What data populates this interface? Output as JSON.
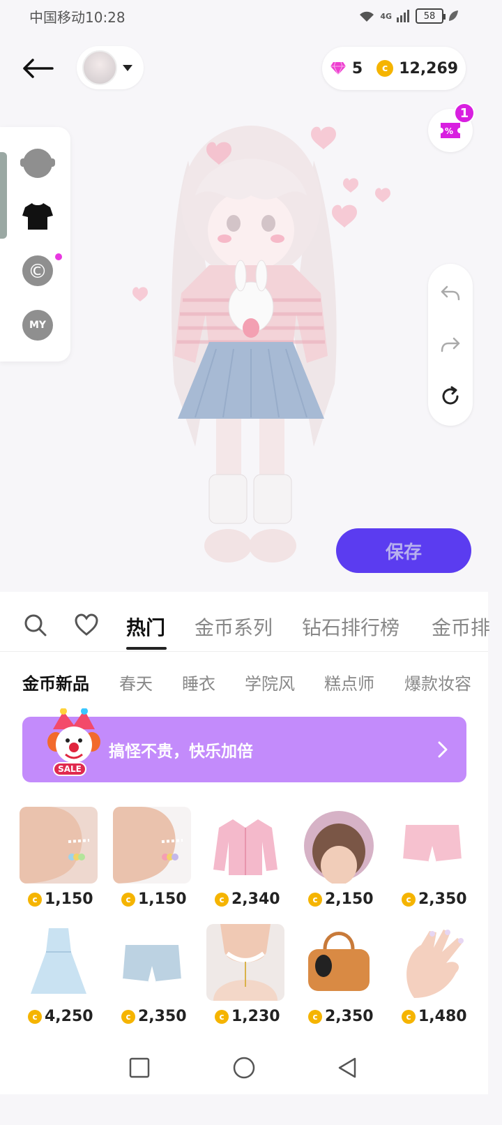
{
  "status_bar": {
    "carrier_time": "中国移动10:28",
    "network": "4G",
    "battery": "58"
  },
  "header": {
    "diamonds": "5",
    "coins": "12,269"
  },
  "coupon": {
    "badge": "1"
  },
  "left_panel": {
    "items": [
      {
        "icon": "head-icon"
      },
      {
        "icon": "shirt-icon"
      },
      {
        "icon": "copyright-icon",
        "label": "©"
      },
      {
        "icon": "my-icon",
        "label": "MY"
      }
    ]
  },
  "save_button": {
    "label": "保存"
  },
  "main_tabs": [
    "热门",
    "金币系列",
    "钻石排行榜",
    "金币排"
  ],
  "sub_tabs": [
    "金币新品",
    "春天",
    "睡衣",
    "学院风",
    "糕点师",
    "爆款妆容"
  ],
  "banner": {
    "text": "搞怪不贵，快乐加倍",
    "sale": "SALE"
  },
  "items": [
    {
      "price": "1,150",
      "kind": "earring-blue"
    },
    {
      "price": "1,150",
      "kind": "earring-pink"
    },
    {
      "price": "2,340",
      "kind": "pink-jacket"
    },
    {
      "price": "2,150",
      "kind": "lace-bonnet"
    },
    {
      "price": "2,350",
      "kind": "pink-shorts"
    },
    {
      "price": "4,250",
      "kind": "blue-dress"
    },
    {
      "price": "2,350",
      "kind": "denim-shorts"
    },
    {
      "price": "1,230",
      "kind": "choker"
    },
    {
      "price": "2,350",
      "kind": "brown-bag"
    },
    {
      "price": "1,480",
      "kind": "nails"
    }
  ],
  "colors": {
    "accent": "#5b3cf0",
    "banner": "#c38bfb",
    "coin": "#f5b400",
    "badge": "#d81fe0"
  }
}
